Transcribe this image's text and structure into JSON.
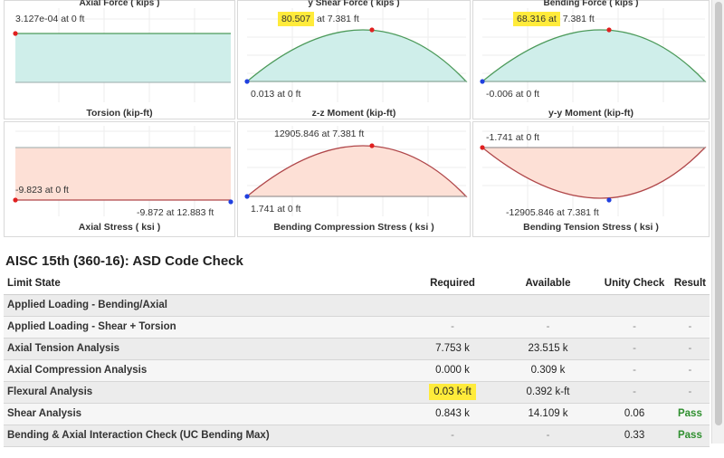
{
  "top_captions": [
    "Axial Force ( kips )",
    "y Shear Force ( kips )",
    "Bending Force ( kips )"
  ],
  "charts": [
    {
      "caption": "Torsion (kip-ft)",
      "label1": "3.127e-04 at 0 ft",
      "label2": ""
    },
    {
      "caption": "z-z Moment  (kip-ft)",
      "label1_value": "80.507",
      "label1_rest": " at 7.381 ft",
      "label2": "0.013 at 0 ft"
    },
    {
      "caption": "y-y Moment  (kip-ft)",
      "label1_value": "68.316 at",
      "label1_rest": " 7.381 ft",
      "label2": "-0.006 at 0 ft"
    },
    {
      "caption": "Axial Stress  ( ksi )",
      "label1": "-9.823 at 0 ft",
      "label2": "-9.872 at 12.883 ft"
    },
    {
      "caption": "Bending Compression Stress  ( ksi )",
      "label1": "12905.846 at 7.381 ft",
      "label2": "1.741 at 0 ft"
    },
    {
      "caption": "Bending Tension Stress  ( ksi )",
      "label1": "-1.741 at 0 ft",
      "label2": "-12905.846 at 7.381 ft"
    }
  ],
  "colors": {
    "teal_fill": "#cfeeea",
    "teal_line": "#4c9a5a",
    "salmon_fill": "#fde0d6",
    "salmon_line": "#b0474a",
    "highlight": "#ffeb3b",
    "pass": "#2f8f2f"
  },
  "code_check": {
    "title": "AISC 15th (360-16): ASD Code Check",
    "headers": {
      "limit_state": "Limit State",
      "required": "Required",
      "available": "Available",
      "unity": "Unity Check",
      "result": "Result"
    },
    "rows": [
      {
        "limit_state": "Applied Loading - Bending/Axial",
        "required": "",
        "available": "",
        "unity": "",
        "result": ""
      },
      {
        "limit_state": "Applied Loading - Shear + Torsion",
        "required": "-",
        "available": "-",
        "unity": "-",
        "result": "-"
      },
      {
        "limit_state": "Axial Tension Analysis",
        "required": "7.753 k",
        "available": "23.515 k",
        "unity": "-",
        "result": "-"
      },
      {
        "limit_state": "Axial Compression Analysis",
        "required": "0.000 k",
        "available": "0.309 k",
        "unity": "-",
        "result": "-"
      },
      {
        "limit_state": "Flexural Analysis",
        "required": "0.03 k-ft",
        "available": "0.392 k-ft",
        "unity": "-",
        "result": "-"
      },
      {
        "limit_state": "Shear Analysis",
        "required": "0.843 k",
        "available": "14.109 k",
        "unity": "0.06",
        "result": "Pass"
      },
      {
        "limit_state": "Bending & Axial Interaction Check (UC Bending Max)",
        "required": "-",
        "available": "-",
        "unity": "0.33",
        "result": "Pass"
      }
    ]
  }
}
